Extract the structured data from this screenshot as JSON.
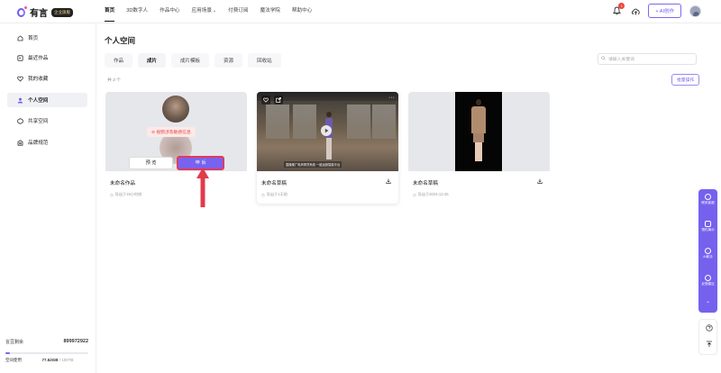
{
  "app": {
    "logo_text": "有言",
    "edition_badge": "企业旗舰"
  },
  "nav": {
    "items": [
      {
        "label": "首页",
        "active": true
      },
      {
        "label": "3D数字人"
      },
      {
        "label": "作品中心"
      },
      {
        "label": "应用场景",
        "has_dropdown": true
      },
      {
        "label": "付费订阅"
      },
      {
        "label": "魔法学院"
      },
      {
        "label": "帮助中心"
      }
    ]
  },
  "top_right": {
    "notification_count": "1",
    "ai_create_label": "+ AI创作"
  },
  "sidebar": {
    "items": [
      {
        "label": "首页",
        "icon": "home-icon"
      },
      {
        "label": "最近作品",
        "icon": "recent-icon"
      },
      {
        "label": "我的收藏",
        "icon": "heart-icon"
      },
      {
        "label": "个人空间",
        "icon": "user-icon",
        "active": true
      },
      {
        "label": "共享空间",
        "icon": "share-icon"
      },
      {
        "label": "品牌规范",
        "icon": "brand-icon"
      }
    ],
    "quota": {
      "label": "言豆剩余",
      "value": "899972922",
      "storage_label": "空间使用",
      "storage_used": "77.62GB",
      "storage_total": " / 100TB",
      "storage_fraction": 0.05
    }
  },
  "main": {
    "title": "个人空间",
    "tabs": [
      {
        "label": "作品"
      },
      {
        "label": "成片",
        "active": true
      },
      {
        "label": "成片模板"
      },
      {
        "label": "资源"
      },
      {
        "label": "回收站"
      }
    ],
    "search_placeholder": "请输入关键词",
    "count_text": "共 3 个",
    "bulk_button": "批量操作"
  },
  "cards": [
    {
      "title": "未命名作品",
      "subtitle": "导出于19小时前",
      "warning": "视频涉及敏感信息",
      "play_label": "预 览",
      "appeal_label": "申 诉"
    },
    {
      "title": "未命名草稿",
      "subtitle": "导出于1天前",
      "caption": "直播推广电商带货系统 一键运营智能平台"
    },
    {
      "title": "未命名草稿",
      "subtitle": "导出于2024-12-25"
    }
  ],
  "float_panel": {
    "items": [
      "联系客服",
      "预约演示",
      "AI助手",
      "反馈建议"
    ]
  },
  "colors": {
    "accent": "#7462ef",
    "warning_text": "#e64545",
    "appeal_border": "#e33a5c",
    "arrow": "#e23b4b"
  }
}
